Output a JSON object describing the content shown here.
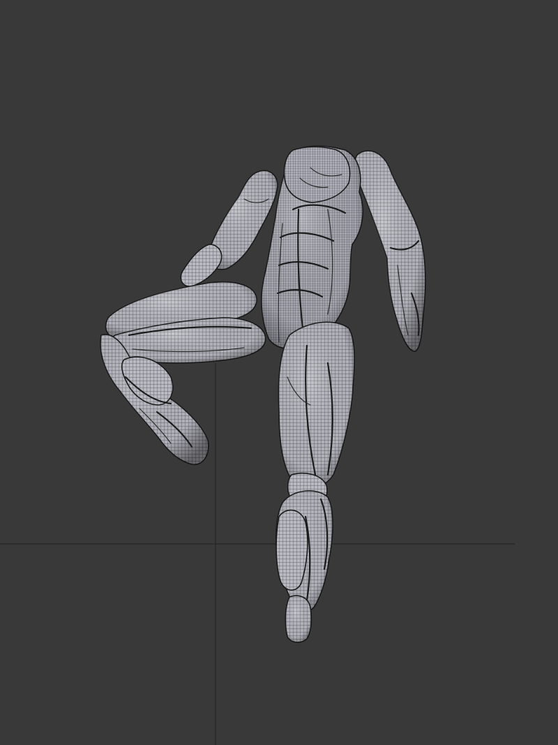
{
  "viewport": {
    "background_color": "#393939",
    "grid_line_color": "#262626",
    "mesh_base_color": "#b7b7bf",
    "mesh_wire_color": "#3a3a3a"
  },
  "scene": {
    "object": "muscle-figure-wireframe"
  }
}
